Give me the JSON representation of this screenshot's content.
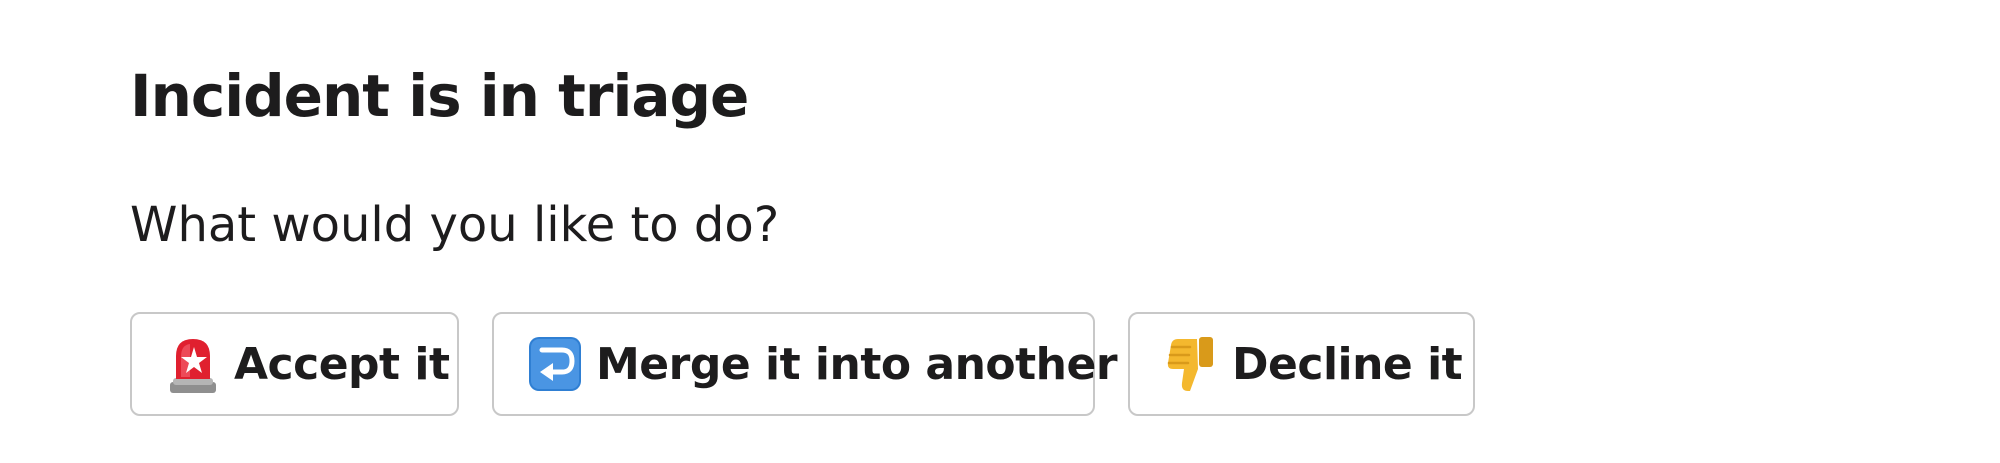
{
  "message": {
    "title": "Incident is in triage",
    "prompt": "What would you like to do?"
  },
  "actions": [
    {
      "label": "Accept it",
      "icon": "rotating-light-icon"
    },
    {
      "label": "Merge it into another",
      "icon": "right-arrow-curving-left-icon"
    },
    {
      "label": "Decline it",
      "icon": "thumbs-down-icon"
    }
  ],
  "colors": {
    "text": "#1d1c1d",
    "button_border": "#c8c8c8",
    "siren_red": "#e0202f",
    "arrow_blue": "#2f7fd3",
    "thumb_yellow": "#f4b82e"
  }
}
